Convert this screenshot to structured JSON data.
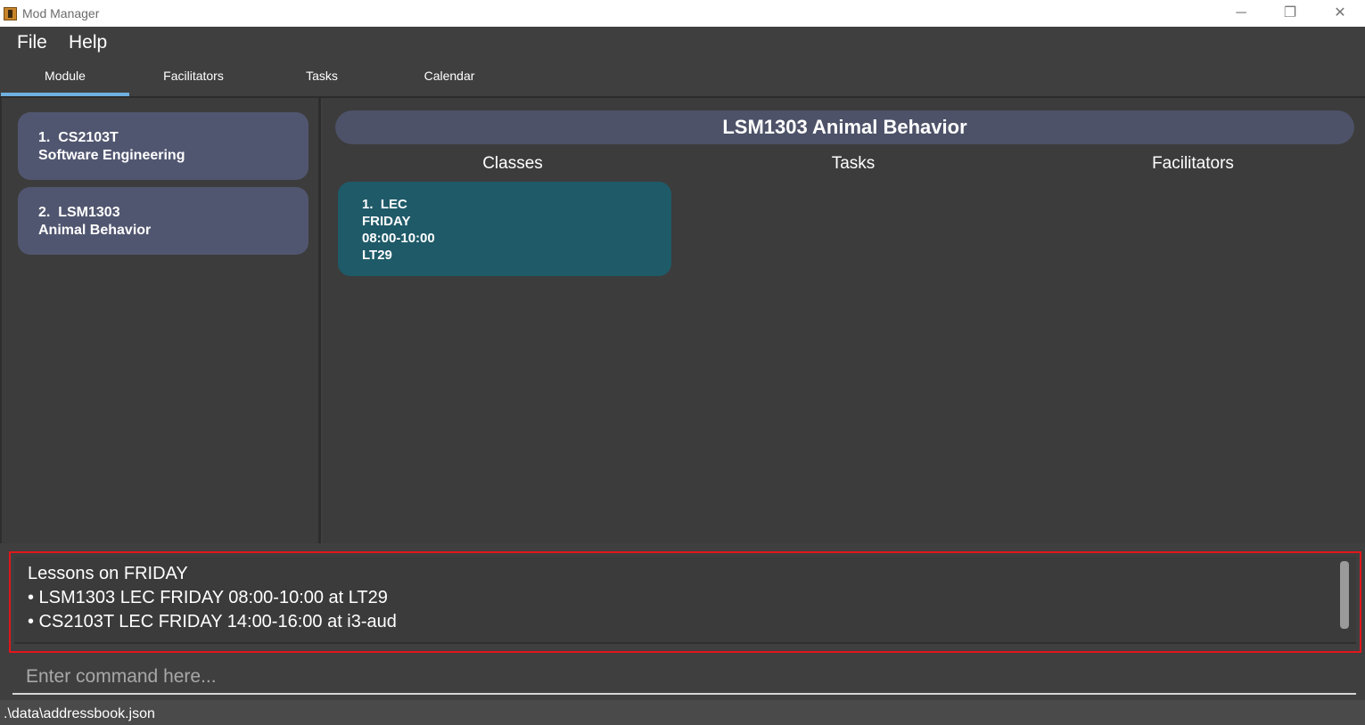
{
  "window": {
    "title": "Mod Manager",
    "minimize": "─",
    "maximize": "❐",
    "close": "✕"
  },
  "menu": {
    "items": [
      "File",
      "Help"
    ]
  },
  "tabs": [
    {
      "label": "Module",
      "active": true
    },
    {
      "label": "Facilitators",
      "active": false
    },
    {
      "label": "Tasks",
      "active": false
    },
    {
      "label": "Calendar",
      "active": false
    }
  ],
  "modules": [
    {
      "index": "1.",
      "code": "CS2103T",
      "name": "Software Engineering"
    },
    {
      "index": "2.",
      "code": "LSM1303",
      "name": "Animal Behavior"
    }
  ],
  "detail": {
    "title": "LSM1303 Animal Behavior",
    "columns": [
      "Classes",
      "Tasks",
      "Facilitators"
    ],
    "classes": [
      {
        "index": "1.",
        "type": "LEC",
        "day": "FRIDAY",
        "time": "08:00-10:00",
        "venue": "LT29"
      }
    ]
  },
  "result": {
    "lines": [
      "Lessons on FRIDAY",
      "• LSM1303 LEC FRIDAY 08:00-10:00 at LT29",
      "• CS2103T LEC FRIDAY 14:00-16:00 at i3-aud"
    ]
  },
  "command": {
    "placeholder": "Enter command here..."
  },
  "status": {
    "path": ".\\data\\addressbook.json"
  },
  "colors": {
    "background": "#3f3f3f",
    "module_card": "#515670",
    "class_card": "#1f5a68",
    "active_tab": "#6fb0e0",
    "result_border": "#e3161c"
  }
}
